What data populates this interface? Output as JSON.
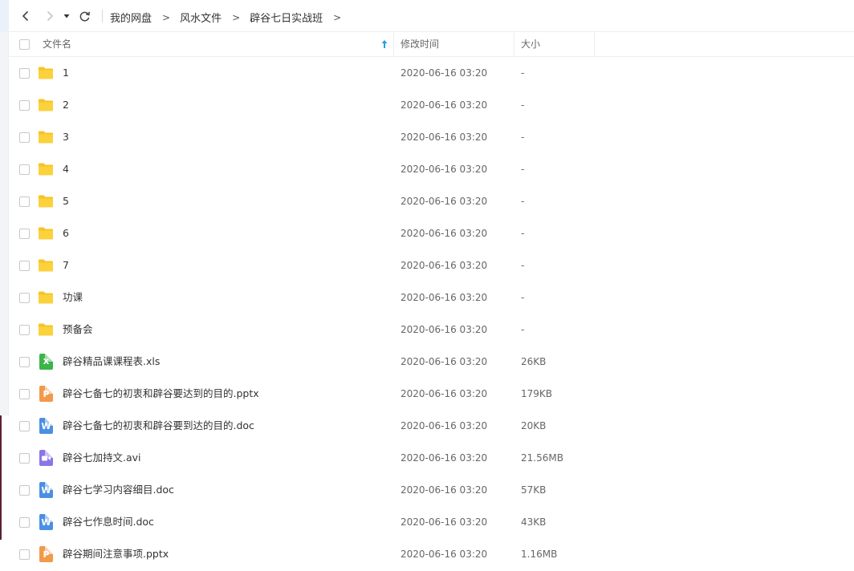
{
  "nav": {
    "back_icon": "chevron-left-icon",
    "forward_icon": "chevron-right-icon",
    "dropdown_icon": "caret-down-icon",
    "refresh_icon": "refresh-icon"
  },
  "breadcrumb": [
    "我的网盘",
    "风水文件",
    "辟谷七日实战班"
  ],
  "columns": {
    "name": "文件名",
    "time": "修改时间",
    "size": "大小"
  },
  "sort_icon": "sort-up-arrow-icon",
  "colors": {
    "folder": "#f7c325",
    "xls": "#3cb44a",
    "pptx": "#f2994a",
    "doc": "#4a90e2",
    "avi": "#8c74e8",
    "accent": "#1e9fe6"
  },
  "files": [
    {
      "name": "1",
      "type": "folder",
      "time": "2020-06-16 03:20",
      "size": "-"
    },
    {
      "name": "2",
      "type": "folder",
      "time": "2020-06-16 03:20",
      "size": "-"
    },
    {
      "name": "3",
      "type": "folder",
      "time": "2020-06-16 03:20",
      "size": "-"
    },
    {
      "name": "4",
      "type": "folder",
      "time": "2020-06-16 03:20",
      "size": "-"
    },
    {
      "name": "5",
      "type": "folder",
      "time": "2020-06-16 03:20",
      "size": "-"
    },
    {
      "name": "6",
      "type": "folder",
      "time": "2020-06-16 03:20",
      "size": "-"
    },
    {
      "name": "7",
      "type": "folder",
      "time": "2020-06-16 03:20",
      "size": "-"
    },
    {
      "name": "功课",
      "type": "folder",
      "time": "2020-06-16 03:20",
      "size": "-"
    },
    {
      "name": "预备会",
      "type": "folder",
      "time": "2020-06-16 03:20",
      "size": "-"
    },
    {
      "name": "辟谷精品课课程表.xls",
      "type": "xls",
      "time": "2020-06-16 03:20",
      "size": "26KB"
    },
    {
      "name": "辟谷七备七的初衷和辟谷要达到的目的.pptx",
      "type": "pptx",
      "time": "2020-06-16 03:20",
      "size": "179KB"
    },
    {
      "name": "辟谷七备七的初衷和辟谷要到达的目的.doc",
      "type": "doc",
      "time": "2020-06-16 03:20",
      "size": "20KB"
    },
    {
      "name": "辟谷七加持文.avi",
      "type": "avi",
      "time": "2020-06-16 03:20",
      "size": "21.56MB"
    },
    {
      "name": "辟谷七学习内容细目.doc",
      "type": "doc",
      "time": "2020-06-16 03:20",
      "size": "57KB"
    },
    {
      "name": "辟谷七作息时间.doc",
      "type": "doc",
      "time": "2020-06-16 03:20",
      "size": "43KB"
    },
    {
      "name": "辟谷期间注意事项.pptx",
      "type": "pptx",
      "time": "2020-06-16 03:20",
      "size": "1.16MB"
    }
  ]
}
